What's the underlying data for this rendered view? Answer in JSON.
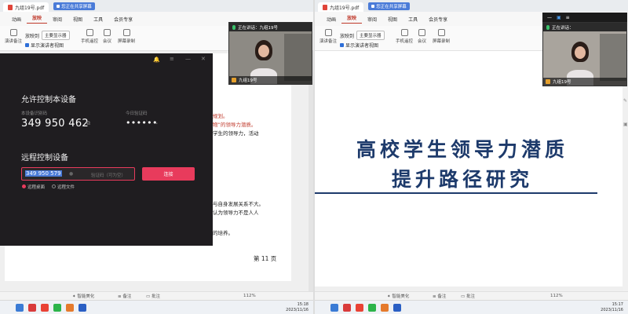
{
  "left": {
    "file_tab": "九组19号.pdf",
    "share_tag": "您正在共享屏幕",
    "menu": [
      "动画",
      "放映",
      "审阅",
      "视图",
      "工具",
      "会员专享"
    ],
    "menu_active_index": 1,
    "ribbon": {
      "select_value": "主要显示器",
      "presenter_label": "放映到",
      "notes_label": "演讲备注",
      "presenter_view_label": "显示演讲者视图",
      "phone_remote": "手机遥控",
      "meeting": "会议",
      "screen_record": "屏幕录制"
    },
    "video": {
      "status": "正在讲话：九组19号",
      "name": "九组19号"
    },
    "remote_dialog": {
      "allow_title": "允许控制本设备",
      "device_code_label": "本设备识别码",
      "device_code": "349 950 462",
      "verify_label": "今日验证码",
      "verify_code": "••••••",
      "remote_title": "远程控制设备",
      "input_value": "349 950 579",
      "verify_placeholder": "验证码（可为空）",
      "connect": "连接",
      "option_desktop": "远程桌面",
      "option_file": "远程文件"
    },
    "doc_lines": [
      {
        "text": "规划。",
        "red": true
      },
      {
        "text": "物”的领导力潜质。",
        "red": true
      },
      {
        "text": "学生的领导力，活动",
        "red": false
      },
      {
        "text": "与自身发展关系不大。",
        "red": false
      },
      {
        "text": "认为领导力不是人人",
        "red": false
      },
      {
        "text": "的培养。",
        "red": false
      }
    ],
    "page_label": "第 11 页",
    "status": {
      "beautify": "智能美化",
      "notes": "备注",
      "comment": "批注",
      "zoom": "112%"
    },
    "clock": {
      "time": "15:18",
      "date": "2023/11/16"
    }
  },
  "right": {
    "file_tab": "九组19号.pdf",
    "share_tag": "您正在共享屏幕",
    "menu": [
      "动画",
      "放映",
      "审阅",
      "视图",
      "工具",
      "会员专享"
    ],
    "menu_active_index": 1,
    "ribbon": {
      "select_value": "主要显示器",
      "presenter_label": "放映到",
      "notes_label": "演讲备注",
      "presenter_view_label": "显示演讲者视图",
      "phone_remote": "手机遥控",
      "meeting": "会议",
      "screen_record": "屏幕录制"
    },
    "video": {
      "status": "正在讲话：",
      "name": "九组19号"
    },
    "slide_title_1": "高校学生领导力潜质",
    "slide_title_2": "提升路径研究",
    "status": {
      "beautify": "智能美化",
      "notes": "备注",
      "comment": "批注",
      "zoom": "112%"
    },
    "clock": {
      "time": "15:17",
      "date": "2023/11/16"
    }
  },
  "colors": {
    "accent": "#c0392b",
    "connect": "#e83b5c",
    "slide_title": "#1d3a6b",
    "share": "#4a7bd8"
  }
}
